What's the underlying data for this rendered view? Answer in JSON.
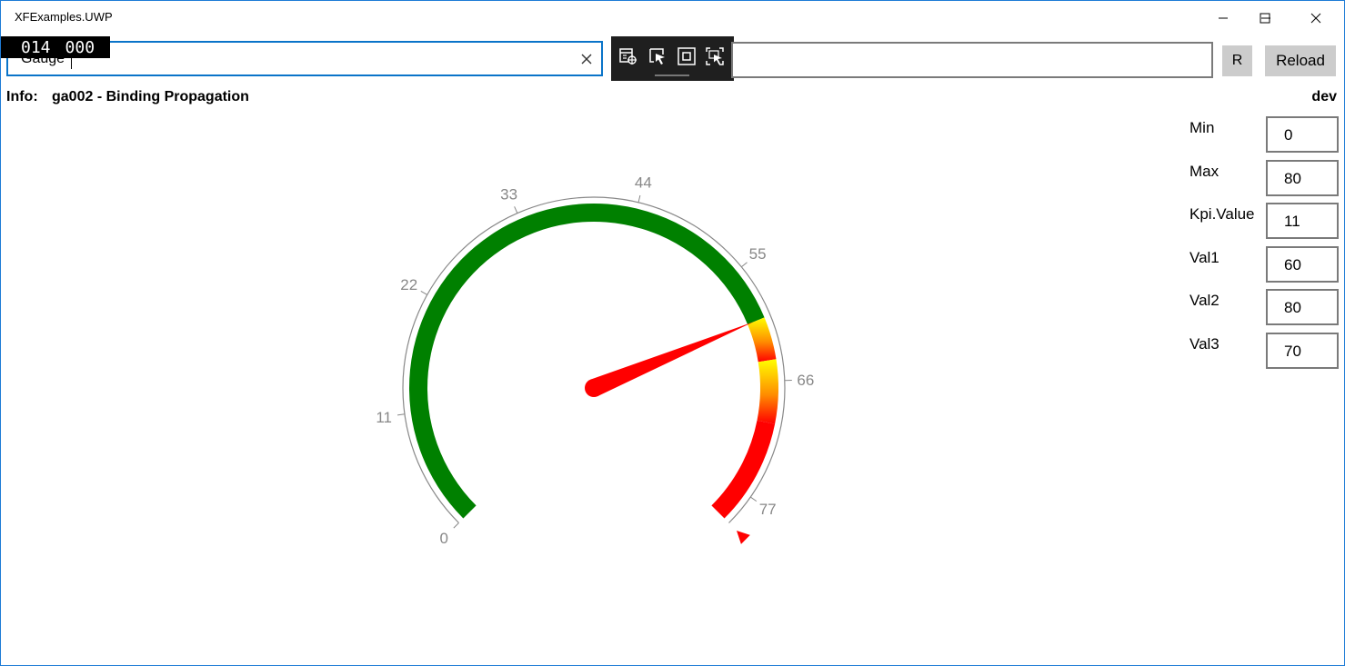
{
  "window": {
    "title": "XFExamples.UWP"
  },
  "counter": {
    "left": "014",
    "right": "000"
  },
  "search": {
    "value": "Gauge"
  },
  "buttons": {
    "r": "R",
    "reload": "Reload"
  },
  "info": {
    "label": "Info:",
    "text": "ga002 - Binding Propagation",
    "mode": "dev"
  },
  "params": [
    {
      "label": "Min",
      "value": "0"
    },
    {
      "label": "Max",
      "value": "80"
    },
    {
      "label": "Kpi.Value",
      "value": "11"
    },
    {
      "label": "Val1",
      "value": "60"
    },
    {
      "label": "Val2",
      "value": "80"
    },
    {
      "label": "Val3",
      "value": "70"
    }
  ],
  "gauge": {
    "min": 0,
    "max": 80,
    "ticks": [
      "0",
      "11",
      "22",
      "33",
      "44",
      "55",
      "66",
      "77"
    ],
    "tick_values": [
      0,
      11,
      22,
      33,
      44,
      55,
      66,
      77
    ],
    "needle_value": 60,
    "marker_value": 80,
    "ranges": [
      {
        "from": 0,
        "to": 60,
        "color": "#008000"
      },
      {
        "from": 60,
        "to": 64,
        "color": "gradient-yellow-red"
      },
      {
        "from": 70,
        "to": 80,
        "color": "#ff0000"
      }
    ],
    "colors": {
      "green": "#008000",
      "needle": "#ff0000",
      "scale": "#888888",
      "marker": "#ff0000"
    }
  }
}
